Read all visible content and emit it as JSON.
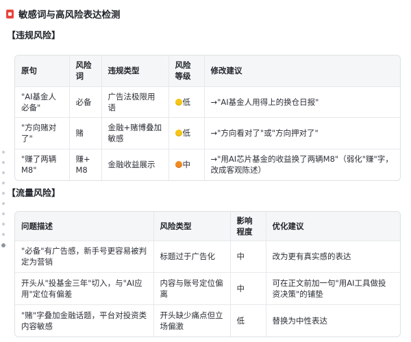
{
  "doc": {
    "title": "敏感词与高风险表达检测",
    "title_icon": "red-document-icon"
  },
  "section1": {
    "heading": "【违规风险】",
    "headers": [
      "原句",
      "风险词",
      "违规类型",
      "风险等级",
      "修改建议"
    ],
    "rows": [
      {
        "sentence": "\"AI基金人必备\"",
        "word": "必备",
        "type": "广告法极限用语",
        "level": "低",
        "level_color": "yellow",
        "suggestion": "→\"AI基金人用得上的换仓日报\""
      },
      {
        "sentence": "\"方向赌对了\"",
        "word": "赌",
        "type": "金融+赌博叠加敏感",
        "level": "低",
        "level_color": "yellow",
        "suggestion": "→\"方向看对了\"或\"方向押对了\""
      },
      {
        "sentence": "\"赚了两辆M8\"",
        "word": "赚+M8",
        "type": "金融收益展示",
        "level": "中",
        "level_color": "orange",
        "suggestion": "→\"用AI芯片基金的收益换了两辆M8\"（弱化\"赚\"字，改成客观陈述）"
      }
    ]
  },
  "section2": {
    "heading": "【流量风险】",
    "headers": [
      "问题描述",
      "风险类型",
      "影响程度",
      "优化建议"
    ],
    "rows": [
      {
        "desc": "\"必备\"有广告感，新手号更容易被判定为营销",
        "type": "标题过于广告化",
        "impact": "中",
        "suggestion": "改为更有真实感的表达"
      },
      {
        "desc": "开头从\"投基金三年\"切入，与\"AI应用\"定位有偏差",
        "type": "内容与账号定位偏离",
        "impact": "中",
        "suggestion": "可在正文前加一句\"用AI工具做投资决策\"的铺垫"
      },
      {
        "desc": "\"赌\"字叠加金融话题，平台对投资类内容敏感",
        "type": "开头缺少痛点但立场偏激",
        "impact": "低",
        "suggestion": "替换为中性表达"
      }
    ]
  },
  "colors": {
    "yellow": "#f5c518",
    "orange": "#f08a24",
    "header_bg": "#f5f6f7",
    "border": "#dee0e3"
  }
}
